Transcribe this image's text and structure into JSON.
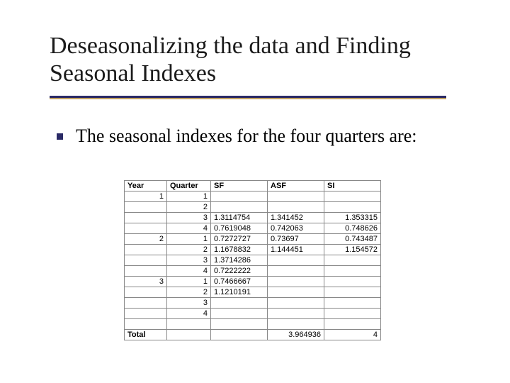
{
  "title": "Deseasonalizing the data and Finding Seasonal Indexes",
  "bullet": "The seasonal indexes for the four quarters are:",
  "table": {
    "headers": {
      "year": "Year",
      "quarter": "Quarter",
      "sf": "SF",
      "asf": "ASF",
      "si": "SI"
    },
    "rows": [
      {
        "year": "1",
        "quarter": "1",
        "sf": "",
        "asf": "",
        "si": ""
      },
      {
        "year": "",
        "quarter": "2",
        "sf": "",
        "asf": "",
        "si": ""
      },
      {
        "year": "",
        "quarter": "3",
        "sf": "1.3114754",
        "asf": "1.341452",
        "si": "1.353315"
      },
      {
        "year": "",
        "quarter": "4",
        "sf": "0.7619048",
        "asf": "0.742063",
        "si": "0.748626"
      },
      {
        "year": "2",
        "quarter": "1",
        "sf": "0.7272727",
        "asf": "0.73697",
        "si": "0.743487"
      },
      {
        "year": "",
        "quarter": "2",
        "sf": "1.1678832",
        "asf": "1.144451",
        "si": "1.154572"
      },
      {
        "year": "",
        "quarter": "3",
        "sf": "1.3714286",
        "asf": "",
        "si": ""
      },
      {
        "year": "",
        "quarter": "4",
        "sf": "0.7222222",
        "asf": "",
        "si": ""
      },
      {
        "year": "3",
        "quarter": "1",
        "sf": "0.7466667",
        "asf": "",
        "si": ""
      },
      {
        "year": "",
        "quarter": "2",
        "sf": "1.1210191",
        "asf": "",
        "si": ""
      },
      {
        "year": "",
        "quarter": "3",
        "sf": "",
        "asf": "",
        "si": ""
      },
      {
        "year": "",
        "quarter": "4",
        "sf": "",
        "asf": "",
        "si": ""
      },
      {
        "year": "",
        "quarter": "",
        "sf": "",
        "asf": "",
        "si": ""
      }
    ],
    "total": {
      "label": "Total",
      "asf": "3.964936",
      "si": "4"
    }
  },
  "chart_data": {
    "type": "table",
    "title": "Seasonal Indexes",
    "columns": [
      "Year",
      "Quarter",
      "SF",
      "ASF",
      "SI"
    ],
    "rows": [
      [
        1,
        1,
        null,
        null,
        null
      ],
      [
        1,
        2,
        null,
        null,
        null
      ],
      [
        1,
        3,
        1.3114754,
        1.341452,
        1.353315
      ],
      [
        1,
        4,
        0.7619048,
        0.742063,
        0.748626
      ],
      [
        2,
        1,
        0.7272727,
        0.73697,
        0.743487
      ],
      [
        2,
        2,
        1.1678832,
        1.144451,
        1.154572
      ],
      [
        2,
        3,
        1.3714286,
        null,
        null
      ],
      [
        2,
        4,
        0.7222222,
        null,
        null
      ],
      [
        3,
        1,
        0.7466667,
        null,
        null
      ],
      [
        3,
        2,
        1.1210191,
        null,
        null
      ],
      [
        3,
        3,
        null,
        null,
        null
      ],
      [
        3,
        4,
        null,
        null,
        null
      ]
    ],
    "totals": {
      "ASF": 3.964936,
      "SI": 4
    }
  }
}
